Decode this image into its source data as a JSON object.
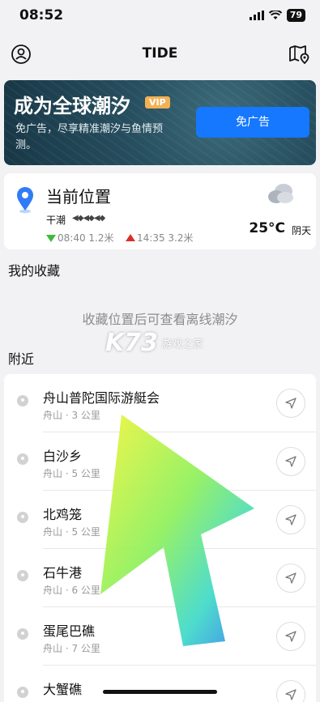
{
  "status": {
    "time": "08:52",
    "battery": "79"
  },
  "nav": {
    "title": "TIDE"
  },
  "banner": {
    "title": "成为全球潮汐",
    "badge": "VIP",
    "description": "免广告，尽享精准潮汐与鱼情预测。",
    "button": "免广告"
  },
  "location": {
    "title": "当前位置",
    "tide_state": "干潮",
    "low_tide": "08:40 1.2米",
    "high_tide": "14:35 3.2米",
    "temperature": "25°C",
    "weather": "阴天"
  },
  "favorites": {
    "title": "我的收藏",
    "empty_hint": "收藏位置后可查看离线潮汐"
  },
  "watermark": {
    "logo": "K73",
    "text": "游戏之家"
  },
  "nearby": {
    "title": "附近",
    "items": [
      {
        "name": "舟山普陀国际游艇会",
        "meta": "舟山 · 3 公里"
      },
      {
        "name": "白沙乡",
        "meta": "舟山 · 5 公里"
      },
      {
        "name": "北鸡笼",
        "meta": "舟山 · 5 公里"
      },
      {
        "name": "石牛港",
        "meta": "舟山 · 6 公里"
      },
      {
        "name": "蛋尾巴礁",
        "meta": "舟山 · 7 公里"
      },
      {
        "name": "大蟹礁",
        "meta": ""
      }
    ]
  },
  "colors": {
    "accent": "#1677ff",
    "low": "#3fba3c",
    "high": "#d9302a",
    "vip": "#f3b154"
  }
}
